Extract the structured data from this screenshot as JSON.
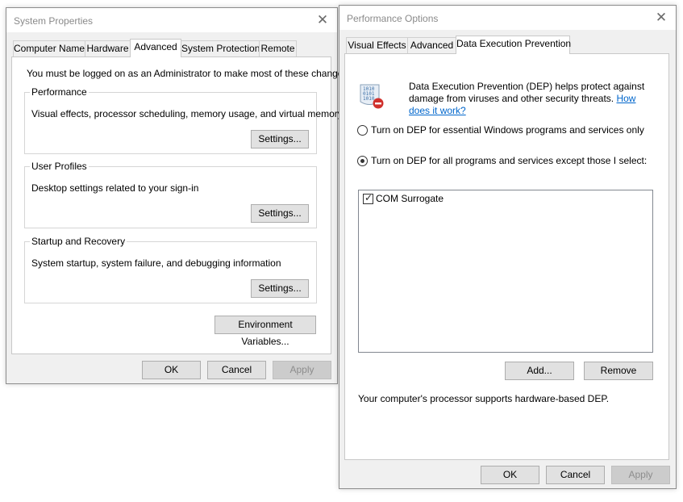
{
  "system_properties": {
    "title": "System Properties",
    "close_glyph": "✕",
    "tabs": [
      {
        "label": "Computer Name"
      },
      {
        "label": "Hardware"
      },
      {
        "label": "Advanced"
      },
      {
        "label": "System Protection"
      },
      {
        "label": "Remote"
      }
    ],
    "active_tab": "Advanced",
    "admin_note": "You must be logged on as an Administrator to make most of these changes.",
    "groups": {
      "performance": {
        "title": "Performance",
        "description": "Visual effects, processor scheduling, memory usage, and virtual memory",
        "button": "Settings..."
      },
      "user_profiles": {
        "title": "User Profiles",
        "description": "Desktop settings related to your sign-in",
        "button": "Settings..."
      },
      "startup_recovery": {
        "title": "Startup and Recovery",
        "description": "System startup, system failure, and debugging information",
        "button": "Settings..."
      }
    },
    "env_button": "Environment Variables...",
    "footer": {
      "ok": "OK",
      "cancel": "Cancel",
      "apply": "Apply"
    }
  },
  "performance_options": {
    "title": "Performance Options",
    "close_glyph": "✕",
    "tabs": [
      {
        "label": "Visual Effects"
      },
      {
        "label": "Advanced"
      },
      {
        "label": "Data Execution Prevention"
      }
    ],
    "active_tab": "Data Execution Prevention",
    "dep_icon_name": "dep-shield-binary-icon",
    "intro_line1": "Data Execution Prevention (DEP) helps protect against",
    "intro_line2": "damage from viruses and other security threats.",
    "link_part1": "How",
    "link_part2": "does it work?",
    "radio_essential": "Turn on DEP for essential Windows programs and services only",
    "radio_all": "Turn on DEP for all programs and services except those I select:",
    "selected_radio": "all",
    "exceptions": [
      {
        "label": "COM Surrogate",
        "checked": true
      }
    ],
    "add_button": "Add...",
    "remove_button": "Remove",
    "processor_note": "Your computer's processor supports hardware-based DEP.",
    "footer": {
      "ok": "OK",
      "cancel": "Cancel",
      "apply": "Apply"
    }
  },
  "colors": {
    "window_bg": "#f0f0f0",
    "panel_bg": "#ffffff",
    "button_bg": "#e1e1e1",
    "link": "#0066cc",
    "title_text": "#8a8a8a"
  }
}
